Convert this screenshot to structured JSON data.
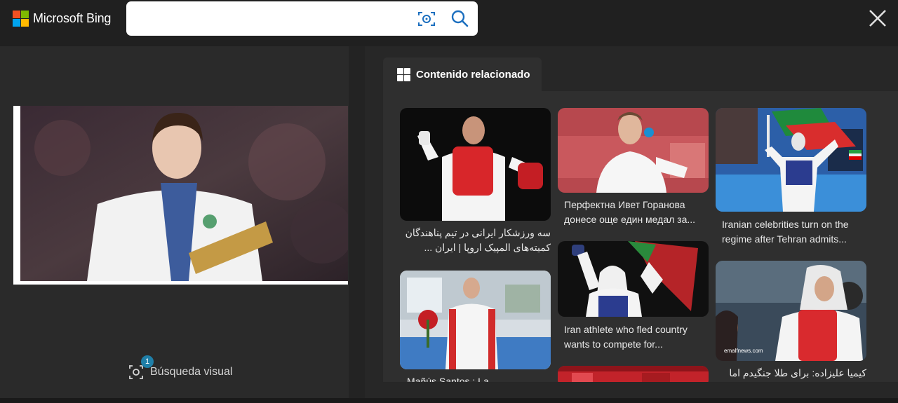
{
  "header": {
    "brand": "Microsoft Bing",
    "search_value": "",
    "icons": [
      "visual-search-icon",
      "search-icon",
      "close-icon"
    ]
  },
  "left": {
    "visual_search_label": "Búsqueda visual",
    "visual_search_badge": "1"
  },
  "related": {
    "tab_label": "Contenido relacionado",
    "cards": [
      {
        "caption": "سه ورزشکار ایرانی در تیم پناهندگان کمیته‌های المپیک اروپا | ایران ...",
        "dir": "rtl"
      },
      {
        "caption": "Mañús Santos : La ...",
        "dir": "ltr"
      },
      {
        "caption": "Перфектна Ивет Горанова донесе още един медал за...",
        "dir": "ltr"
      },
      {
        "caption": "Iran athlete who fled country wants to compete for...",
        "dir": "ltr"
      },
      {
        "caption": "Iranian celebrities turn on the regime after Tehran admits...",
        "dir": "ltr"
      },
      {
        "caption": "کیمیا علیزاده: برای طلا جنگیدم اما برنز",
        "dir": "rtl"
      }
    ],
    "photo_credit": "emalfnews.com"
  },
  "colors": {
    "background": "#202020",
    "panel": "#2f2f2f",
    "accent": "#1f7fa8"
  }
}
